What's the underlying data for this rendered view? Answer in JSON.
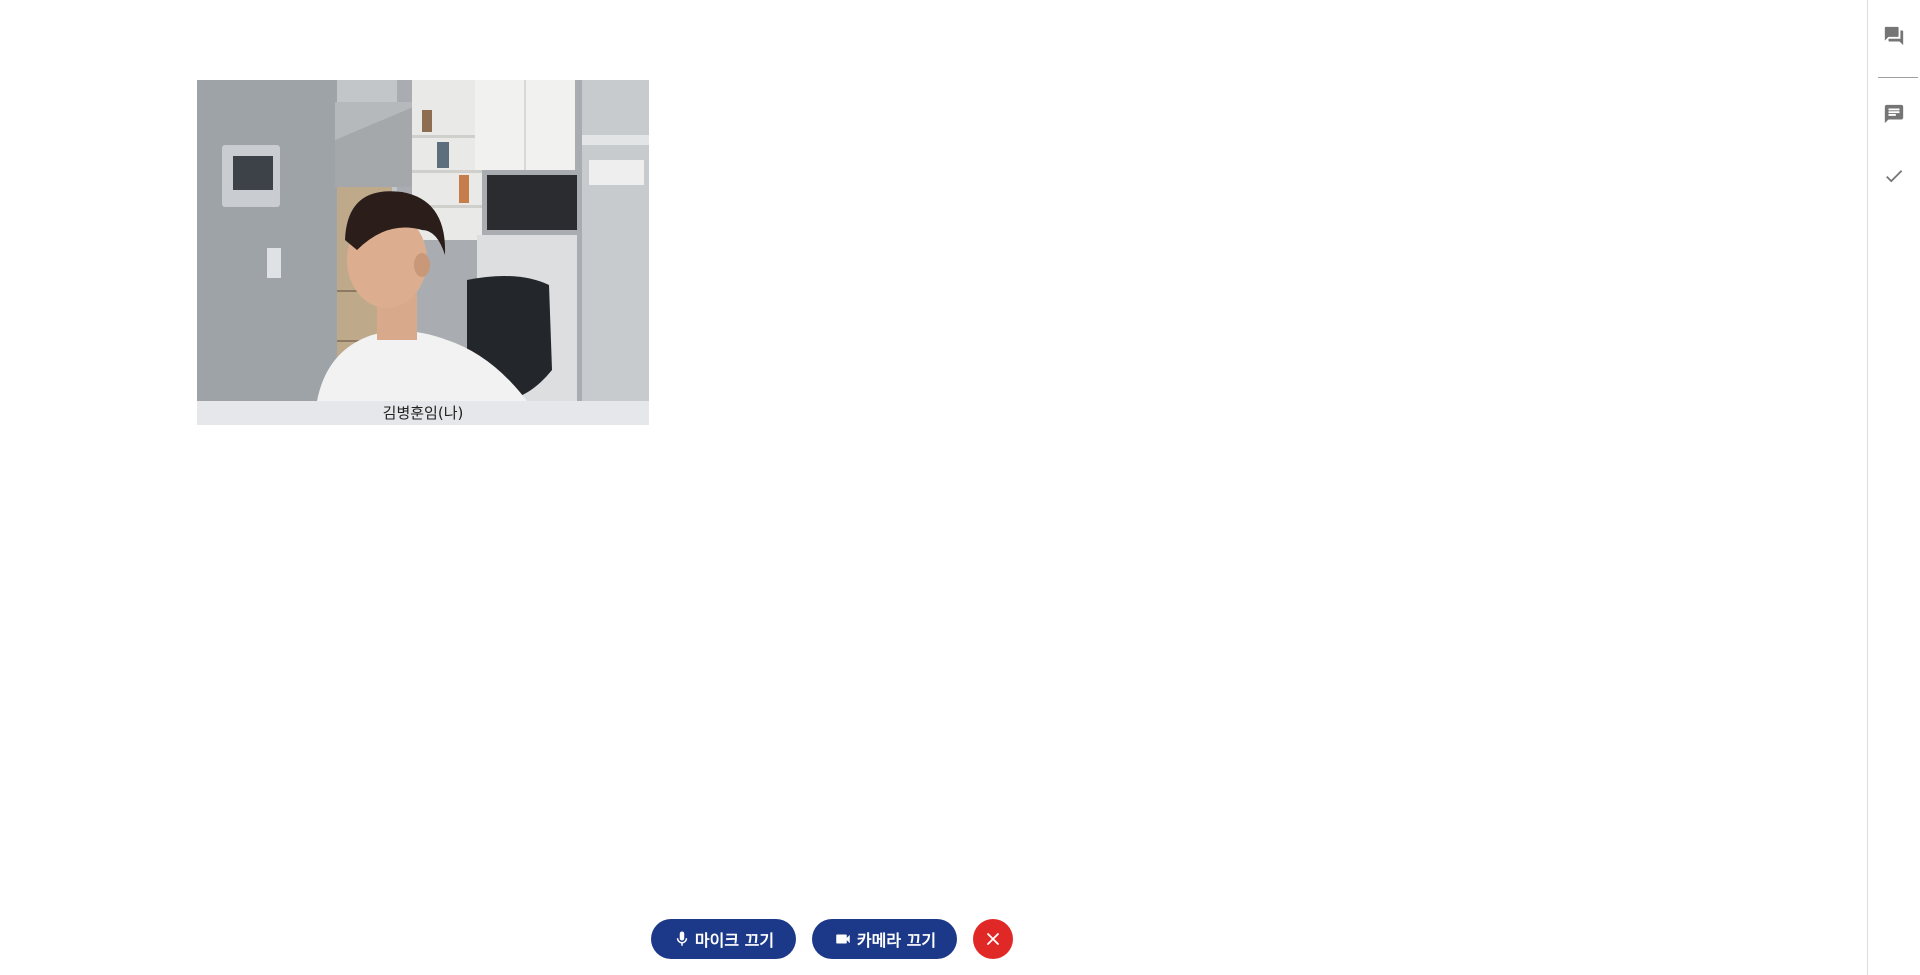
{
  "participant": {
    "name_label": "김병훈임(나)"
  },
  "controls": {
    "mic_label": "마이크 끄기",
    "camera_label": "카메라 끄기",
    "hangup_icon": "close-icon"
  },
  "side_rail": {
    "items": [
      {
        "icon": "forum-icon"
      },
      {
        "icon": "chat-icon"
      },
      {
        "icon": "check-icon"
      }
    ]
  },
  "colors": {
    "primary": "#1c3889",
    "danger": "#e02826",
    "rail_icon": "#757575",
    "name_tag_bg": "#e6e7ea"
  }
}
